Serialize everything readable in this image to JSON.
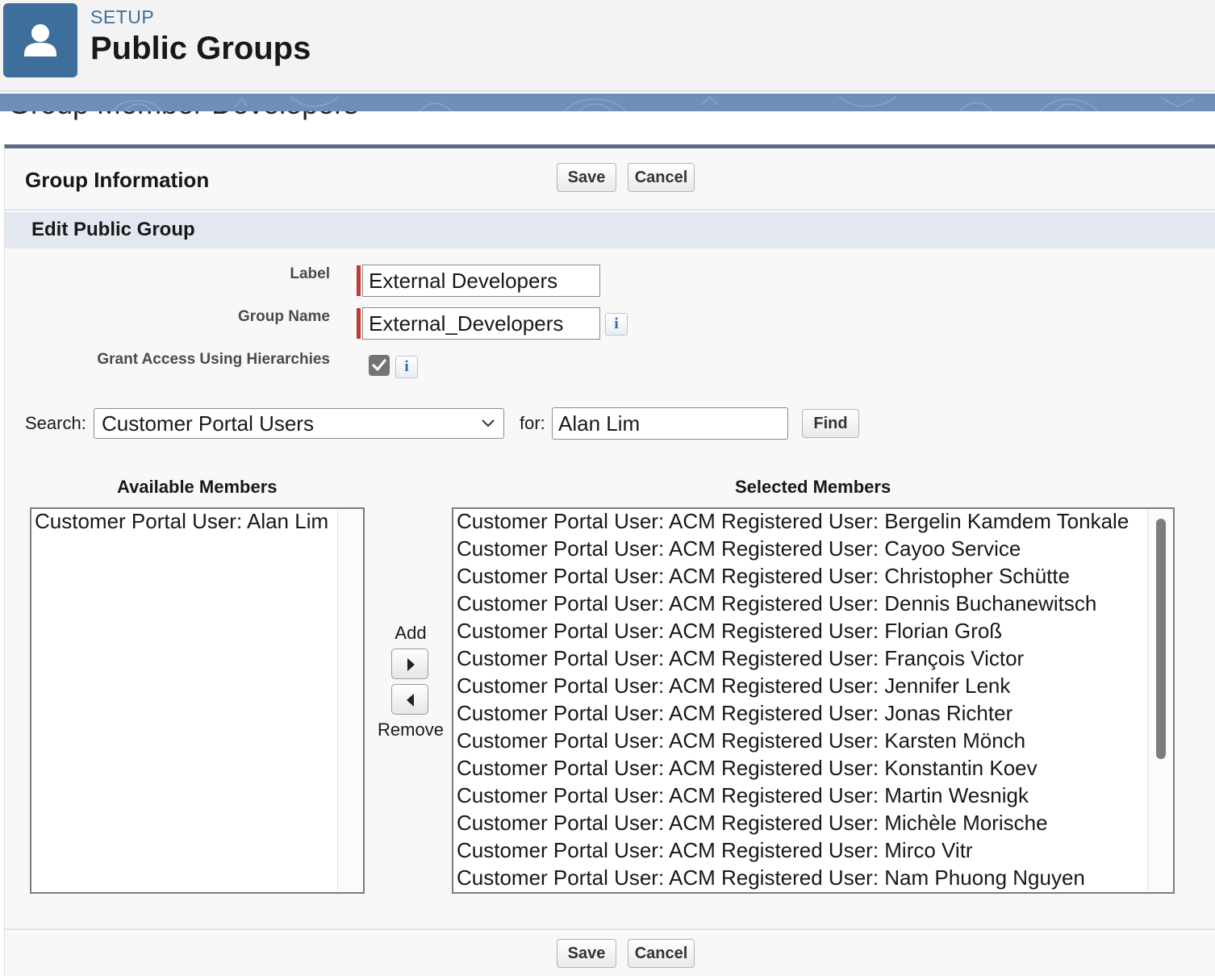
{
  "header": {
    "setup_label": "SETUP",
    "title": "Public Groups",
    "icon": "user-icon",
    "brand_color": "#3e6e9b"
  },
  "panel": {
    "title": "Group Information",
    "save_label": "Save",
    "cancel_label": "Cancel",
    "section_title": "Edit Public Group"
  },
  "form": {
    "label_label": "Label",
    "label_value": "External Developers",
    "group_name_label": "Group Name",
    "group_name_value": "External_Developers",
    "grant_access_label": "Grant Access Using Hierarchies",
    "grant_access_checked": true,
    "info_glyph": "i"
  },
  "search": {
    "search_label": "Search:",
    "selected_option": "Customer Portal Users",
    "for_label": "for:",
    "for_value": "Alan Lim",
    "find_label": "Find"
  },
  "members": {
    "available_title": "Available Members",
    "selected_title": "Selected Members",
    "add_label": "Add",
    "remove_label": "Remove",
    "available": [
      "Customer Portal User: Alan Lim"
    ],
    "selected": [
      "Customer Portal User: ACM Registered User: Bergelin Kamdem Tonkale",
      "Customer Portal User: ACM Registered User: Cayoo Service",
      "Customer Portal User: ACM Registered User: Christopher Schütte",
      "Customer Portal User: ACM Registered User: Dennis Buchanewitsch",
      "Customer Portal User: ACM Registered User: Florian Groß",
      "Customer Portal User: ACM Registered User: François Victor",
      "Customer Portal User: ACM Registered User: Jennifer Lenk",
      "Customer Portal User: ACM Registered User: Jonas Richter",
      "Customer Portal User: ACM Registered User: Karsten Mönch",
      "Customer Portal User: ACM Registered User: Konstantin Koev",
      "Customer Portal User: ACM Registered User: Martin Wesnigk",
      "Customer Portal User: ACM Registered User: Michèle Morische",
      "Customer Portal User: ACM Registered User: Mirco Vitr",
      "Customer Portal User: ACM Registered User: Nam Phuong Nguyen"
    ]
  },
  "colors": {
    "required": "#c23934",
    "section_bar": "#e3e7ef",
    "info_icon": "#2a64b6"
  }
}
